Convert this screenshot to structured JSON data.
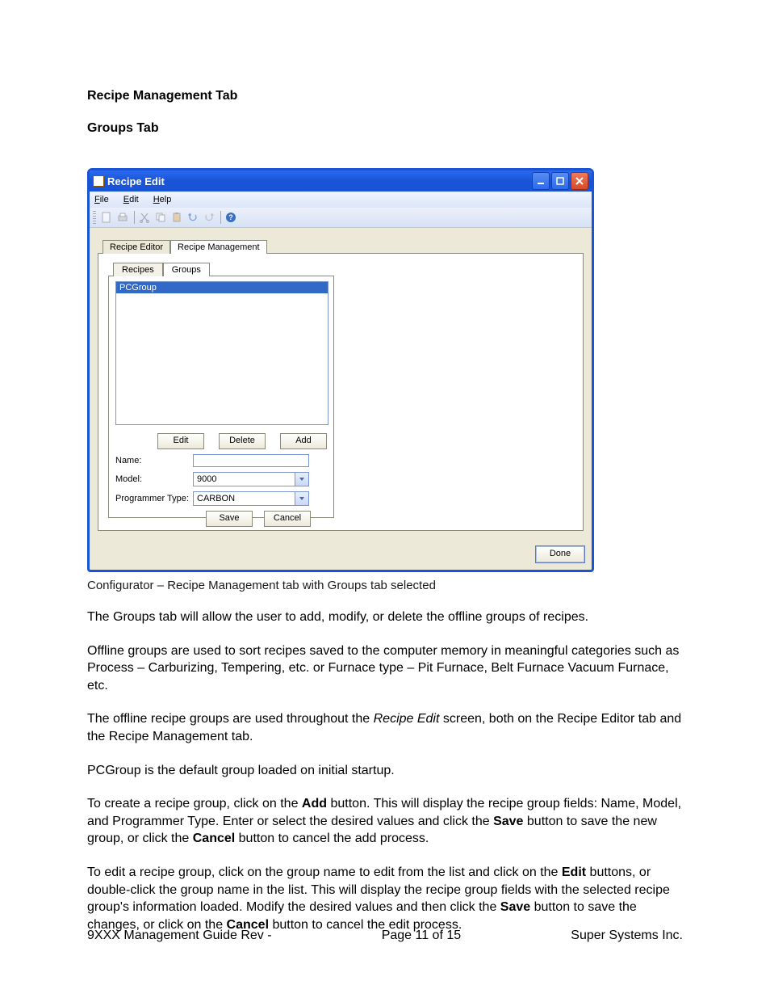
{
  "doc": {
    "heading": "Recipe Management Tab",
    "subheading": "Groups Tab",
    "caption": "Configurator – Recipe Management tab with Groups tab selected",
    "p1": "The Groups tab will allow the user to add, modify, or delete the offline groups of recipes.",
    "p2": "Offline groups are used to sort recipes saved to the computer memory in meaningful categories such as Process – Carburizing, Tempering, etc. or Furnace type – Pit Furnace, Belt Furnace Vacuum Furnace, etc.",
    "p3_a": "The offline recipe groups are used throughout the ",
    "p3_em": "Recipe Edit",
    "p3_b": " screen, both on the Recipe Editor tab and the Recipe Management tab.",
    "p4": "PCGroup is the default group loaded on initial startup.",
    "p5_a": "To create a recipe group, click on the ",
    "p5_add": "Add",
    "p5_b": " button.  This will display the recipe group fields: Name, Model, and Programmer Type.  Enter or select the desired values and click the ",
    "p5_save": "Save",
    "p5_c": " button to save the new group, or click the ",
    "p5_cancel": "Cancel",
    "p5_d": " button to cancel the add process.",
    "p6_a": "To edit a recipe group, click on the group name to edit from the list and click on the ",
    "p6_edit": "Edit",
    "p6_b": " buttons, or double-click the group name in the list.  This will display the recipe group fields with the selected recipe group's information loaded.  Modify the desired values and then click the ",
    "p6_save": "Save",
    "p6_c": " button to save the changes, or click on the ",
    "p6_cancel": "Cancel",
    "p6_d": " button to cancel the edit process.",
    "footer_left": "9XXX Management Guide Rev -",
    "footer_center": "Page 11 of 15",
    "footer_right": "Super Systems Inc."
  },
  "window": {
    "title": "Recipe Edit",
    "menus": {
      "file": "File",
      "file_u": "F",
      "edit": "Edit",
      "edit_u": "E",
      "help": "Help",
      "help_u": "H"
    },
    "tabs_outer": {
      "recipe_editor": "Recipe Editor",
      "recipe_management": "Recipe Management"
    },
    "tabs_inner": {
      "recipes": "Recipes",
      "groups": "Groups"
    },
    "list": {
      "item1": "PCGroup"
    },
    "buttons": {
      "edit": "Edit",
      "delete": "Delete",
      "add": "Add",
      "save": "Save",
      "cancel": "Cancel",
      "done": "Done"
    },
    "form": {
      "name_label": "Name:",
      "model_label": "Model:",
      "model_value": "9000",
      "progtype_label": "Programmer Type:",
      "progtype_value": "CARBON"
    }
  }
}
